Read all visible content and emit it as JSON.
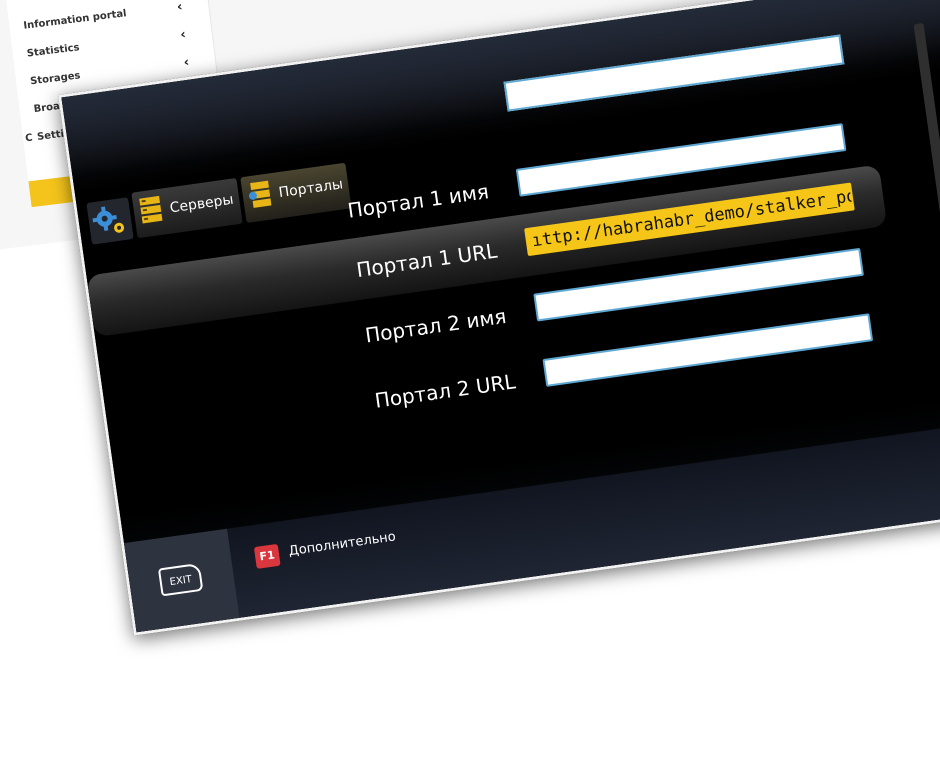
{
  "admin_panel": {
    "menu": [
      {
        "prefix": "",
        "label": "",
        "chevron": ""
      },
      {
        "prefix": "",
        "label": "Information portal",
        "chevron": "‹"
      },
      {
        "prefix": "",
        "label": "Statistics",
        "chevron": "‹"
      },
      {
        "prefix": "",
        "label": "Storages",
        "chevron": "‹"
      },
      {
        "prefix": "",
        "label": "Broadcast servers",
        "chevron": "‹"
      },
      {
        "prefix": "C",
        "label": "Settings",
        "chevron": "‹"
      }
    ],
    "accent_color": "#f4c41c"
  },
  "tv": {
    "tabs": [
      {
        "label": "Серверы",
        "icon": "server-stack-icon"
      },
      {
        "label": "Порталы",
        "icon": "portal-server-icon"
      }
    ],
    "gear_icon": "gears-icon",
    "rows": [
      {
        "label": "Портал 1 имя",
        "value": "",
        "selected": false
      },
      {
        "label": "Портал 1 URL",
        "value": "ıttp://habrahabr_demo/stalker_portal/c/",
        "selected": true
      },
      {
        "label": "Портал 2 имя",
        "value": "",
        "selected": false
      },
      {
        "label": "Портал 2 URL",
        "value": "",
        "selected": false
      }
    ],
    "footer": {
      "exit_label": "EXIT",
      "f1_key": "F1",
      "f1_label": "Дополнительно"
    },
    "colors": {
      "selected_field": "#f5c518",
      "field_border": "#5fa8d3",
      "f1_key": "#d9363e"
    }
  }
}
